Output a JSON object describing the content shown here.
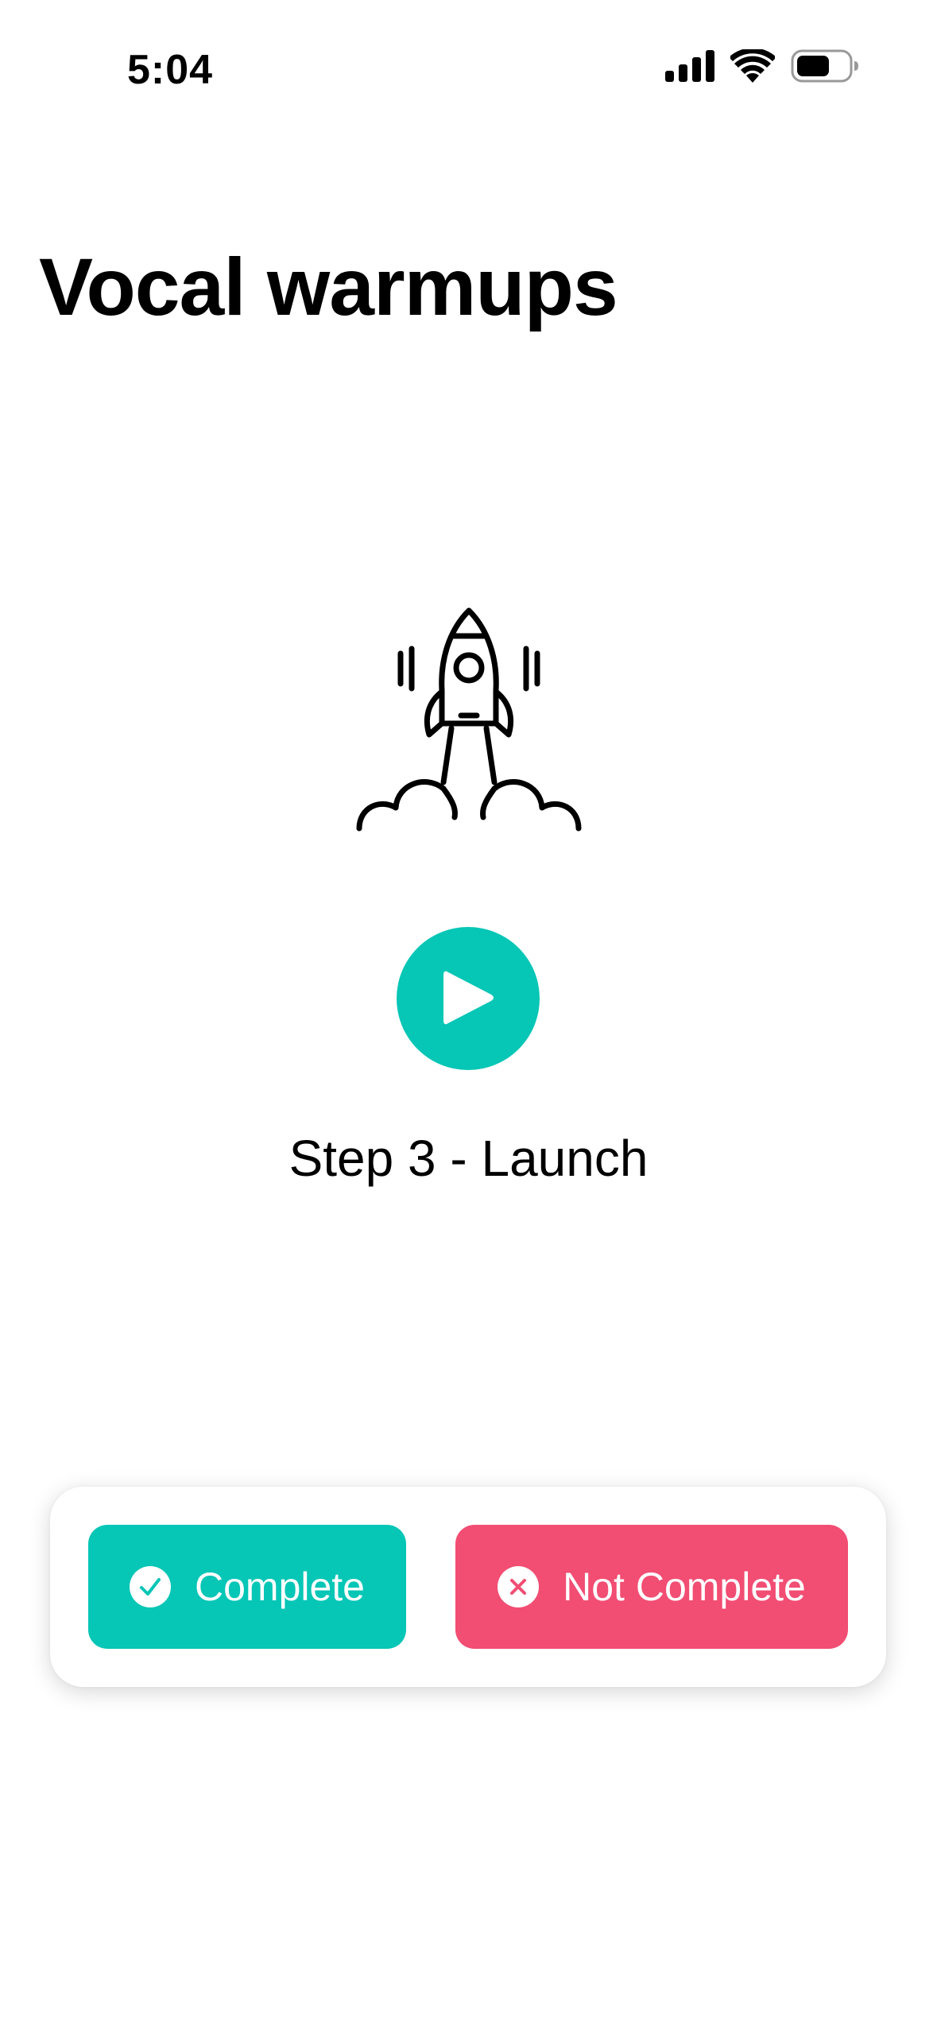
{
  "status_bar": {
    "time": "5:04",
    "icons": [
      "cellular-signal-icon",
      "wifi-icon",
      "battery-icon"
    ]
  },
  "page": {
    "title": "Vocal warmups"
  },
  "step": {
    "illustration": "rocket-launch-icon",
    "play_icon": "play-icon",
    "label": "Step 3 - Launch"
  },
  "actions": {
    "complete_label": "Complete",
    "not_complete_label": "Not Complete"
  },
  "colors": {
    "accent_teal": "#06c6b6",
    "accent_pink": "#f24d73",
    "background": "#ffffff",
    "text": "#000000"
  }
}
